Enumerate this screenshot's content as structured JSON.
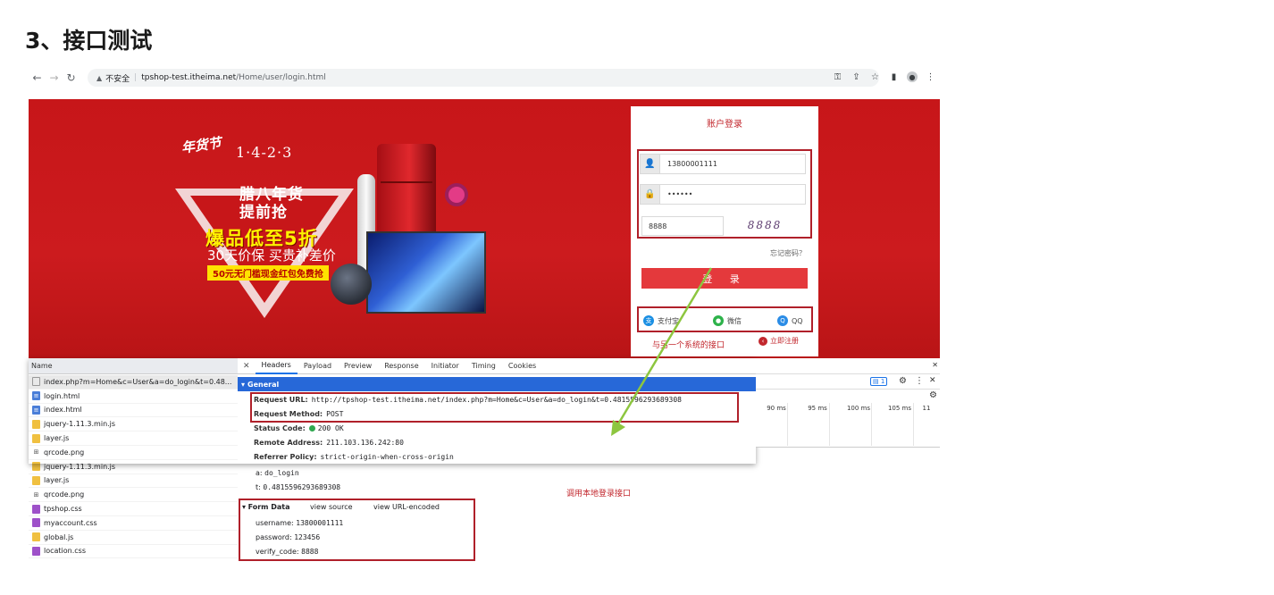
{
  "heading": "3、接口测试",
  "browser": {
    "security_label": "不安全",
    "url_host": "tpshop-test.itheima.net",
    "url_path": "/Home/user/login.html"
  },
  "banner": {
    "logo_text": "年货节",
    "date_text": "1·4-2·3",
    "promo_line1": "腊八年货",
    "promo_line2": "提前抢",
    "promo_line3": "爆品低至5折",
    "promo_line4": "30天价保  买贵补差价",
    "promo_line5": "50元无门槛现金红包免费抢"
  },
  "login": {
    "title": "账户登录",
    "username_value": "13800001111",
    "password_value": "••••••",
    "code_value": "8888",
    "captcha_text": "8888",
    "forgot_label": "忘记密码？",
    "login_button": "登  录",
    "alipay_label": "支付宝",
    "wechat_label": "微信",
    "qq_label": "QQ",
    "register_label": "立即注册"
  },
  "annotations": {
    "other_system": "与另一个系统的接口",
    "local_login": "调用本地登录接口"
  },
  "devtools": {
    "name_header": "Name",
    "requests": [
      {
        "name": "index.php?m=Home&c=User&a=do_login&t=0.48...",
        "type": "doc",
        "icon": "file-icon"
      },
      {
        "name": "login.html",
        "type": "html",
        "icon": "html-file-icon"
      },
      {
        "name": "index.html",
        "type": "html",
        "icon": "html-file-icon"
      },
      {
        "name": "jquery-1.11.3.min.js",
        "type": "js",
        "icon": "js-file-icon"
      },
      {
        "name": "layer.js",
        "type": "js",
        "icon": "js-file-icon"
      },
      {
        "name": "qrcode.png",
        "type": "img",
        "icon": "image-file-icon"
      },
      {
        "name": "jquery-1.11.3.min.js",
        "type": "js",
        "icon": "js-file-icon"
      },
      {
        "name": "layer.js",
        "type": "js",
        "icon": "js-file-icon"
      },
      {
        "name": "qrcode.png",
        "type": "img",
        "icon": "image-file-icon"
      },
      {
        "name": "tpshop.css",
        "type": "css",
        "icon": "css-file-icon"
      },
      {
        "name": "myaccount.css",
        "type": "css",
        "icon": "css-file-icon"
      },
      {
        "name": "global.js",
        "type": "js",
        "icon": "js-file-icon"
      },
      {
        "name": "location.css",
        "type": "css",
        "icon": "css-file-icon"
      }
    ],
    "tabs": [
      "Headers",
      "Payload",
      "Preview",
      "Response",
      "Initiator",
      "Timing",
      "Cookies"
    ],
    "active_tab": "Headers",
    "general_label": "General",
    "request_url_key": "Request URL:",
    "request_url_value": "http://tpshop-test.itheima.net/index.php?m=Home&c=User&a=do_login&t=0.4815596293689308",
    "request_method_key": "Request Method:",
    "request_method_value": "POST",
    "status_code_key": "Status Code:",
    "status_code_value": "200 OK",
    "remote_address_key": "Remote Address:",
    "remote_address_value": "211.103.136.242:80",
    "referrer_policy_key": "Referrer Policy:",
    "referrer_policy_value": "strict-origin-when-cross-origin",
    "query_a_key": "a:",
    "query_a_value": "do_login",
    "query_t_key": "t:",
    "query_t_value": "0.4815596293689308",
    "form_data_label": "Form Data",
    "view_source": "view source",
    "view_url_encoded": "view URL-encoded",
    "username_key": "username:",
    "username_value": "13800001111",
    "password_key": "password:",
    "password_value": "123456",
    "verify_code_key": "verify_code:",
    "verify_code_value": "8888",
    "issues_badge": "1",
    "timeline_labels": [
      "90 ms",
      "95 ms",
      "100 ms",
      "105 ms",
      "11"
    ]
  },
  "colors": {
    "banner_red": "#c71619",
    "accent_red": "#c2272d",
    "devtools_blue": "#2768d8",
    "annotation_green": "#8dc63f"
  }
}
